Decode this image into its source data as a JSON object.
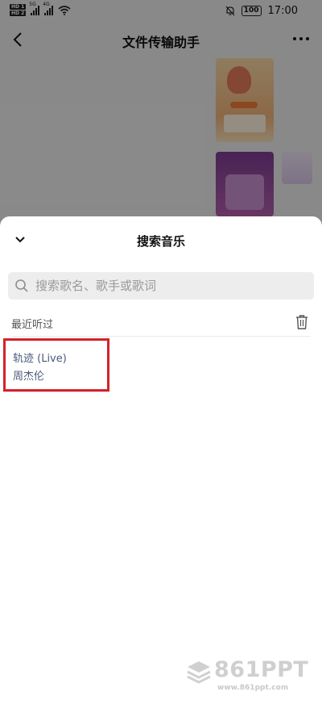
{
  "status_bar": {
    "sim1": "HD 1",
    "sim2": "HD 2",
    "net1": "5G",
    "net2": "4G",
    "battery": "100",
    "time": "17:00"
  },
  "nav": {
    "title": "文件传输助手"
  },
  "music_sheet": {
    "title": "搜索音乐",
    "search": {
      "placeholder": "搜索歌名、歌手或歌词",
      "value": ""
    },
    "recent_label": "最近听过",
    "recent_items": [
      {
        "title": "轨迹 (Live)",
        "artist": "周杰伦"
      }
    ],
    "highlight_color": "#d2232a"
  },
  "watermark": {
    "brand": "861PPT",
    "url": "www.861ppt.com"
  },
  "icons": {
    "back": "chevron-left-icon",
    "more": "more-dots-icon",
    "collapse": "chevron-down-icon",
    "search": "search-icon",
    "trash": "trash-icon"
  }
}
